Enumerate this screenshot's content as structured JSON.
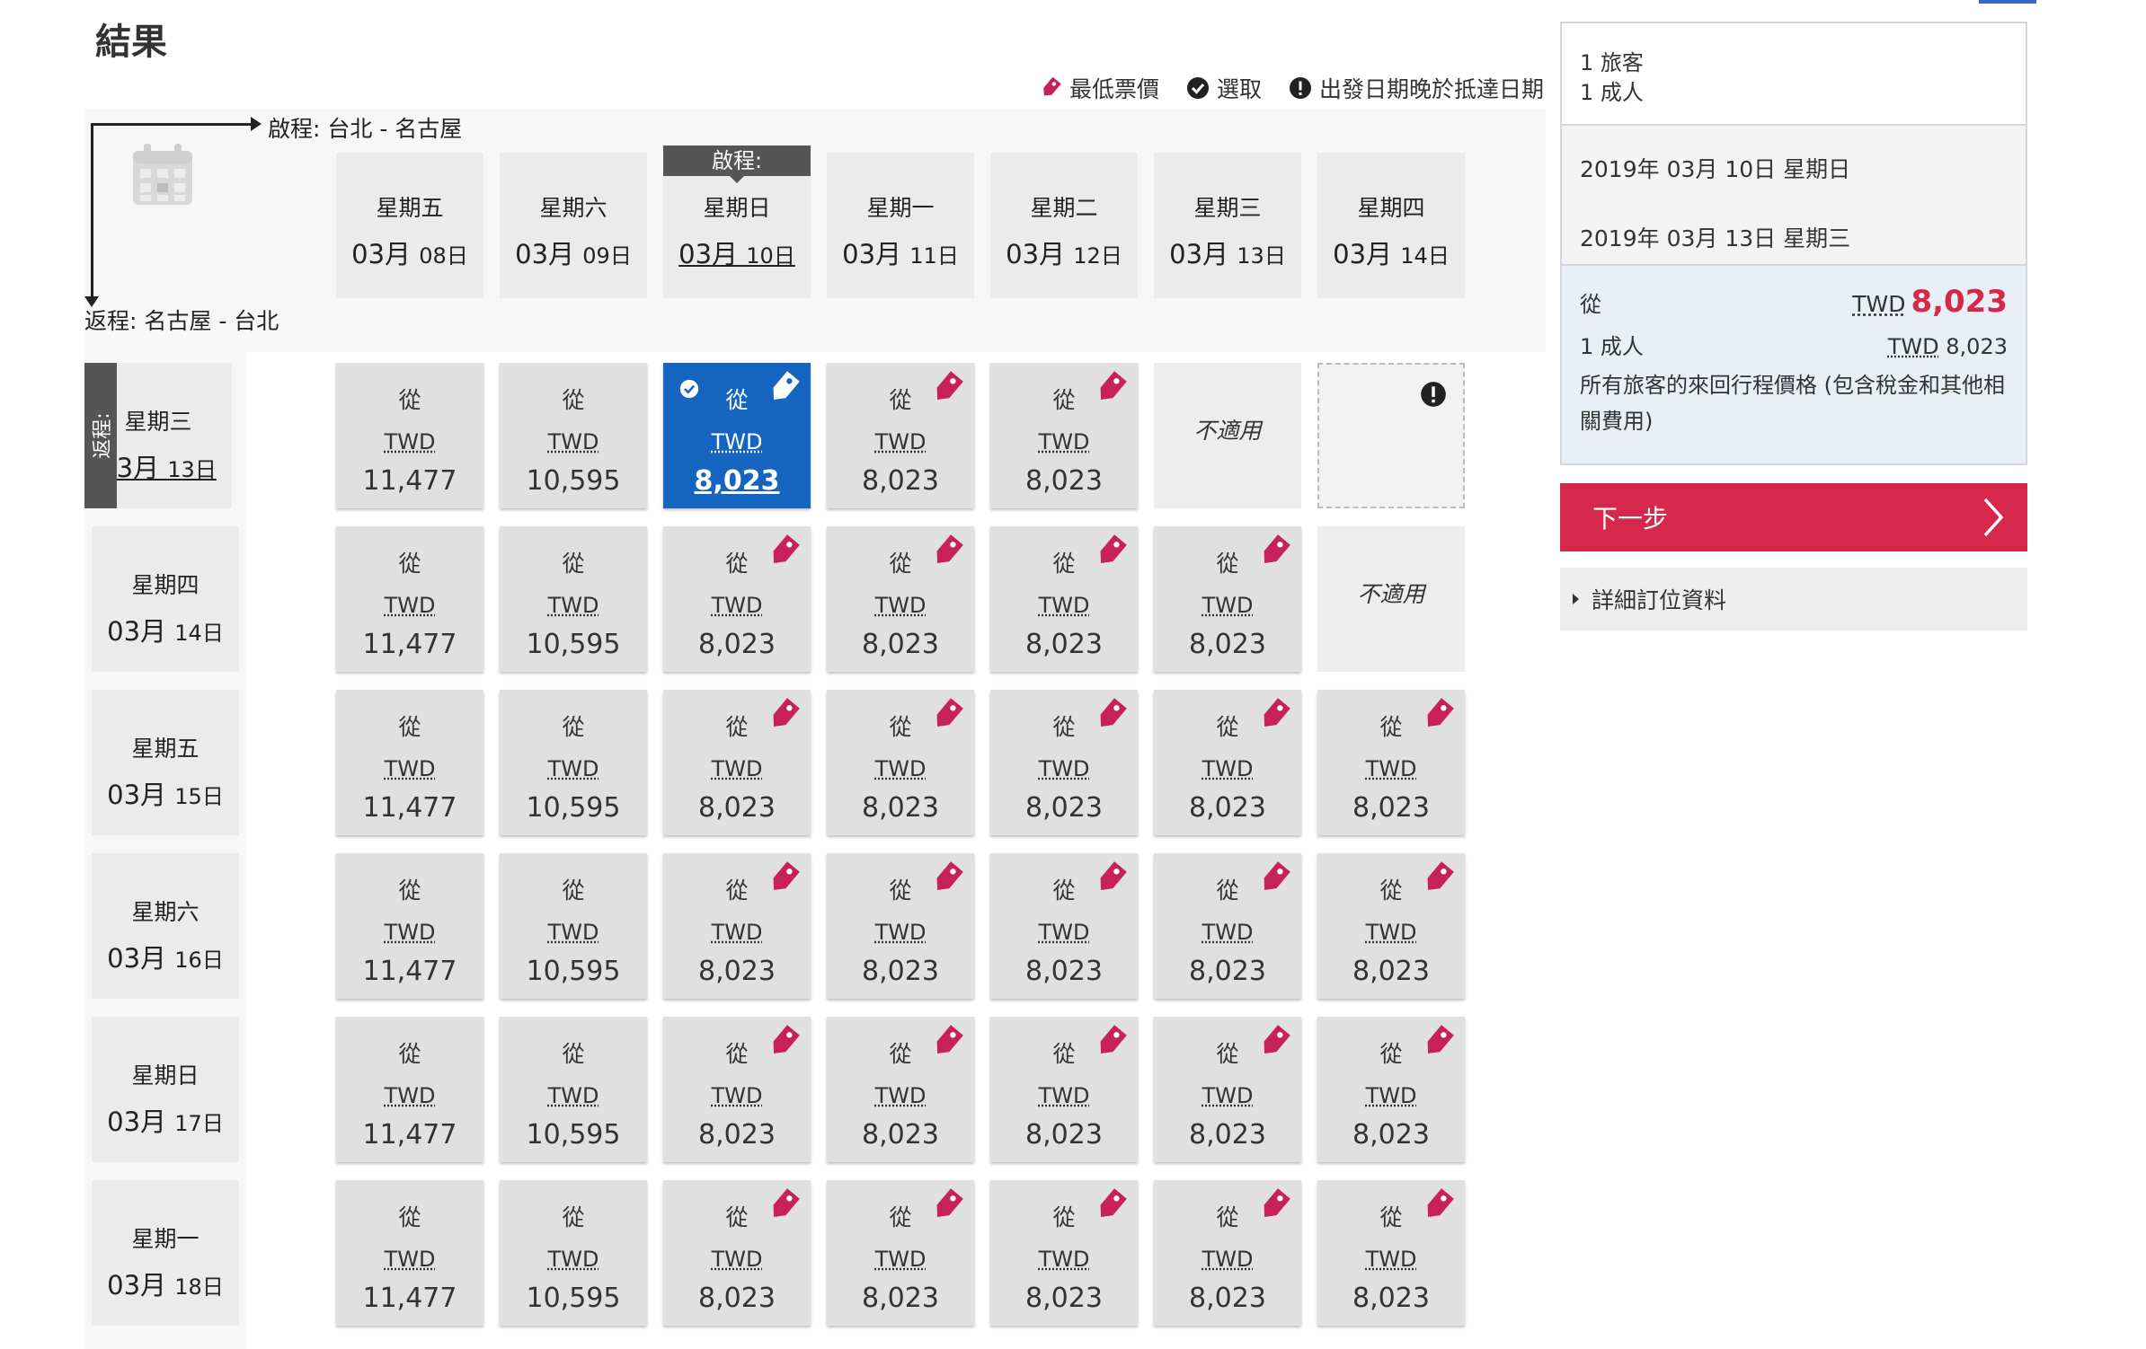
{
  "page_title": "結果",
  "legend": {
    "lowest_fare": "最低票價",
    "selected": "選取",
    "departure_after_arrival": "出發日期晚於抵達日期"
  },
  "grid": {
    "outbound_label": "啟程: 台北 - 名古屋",
    "return_label": "返程: 名古屋 - 台北",
    "selected_outbound_tag": "啟程:",
    "selected_return_tag": "返程:",
    "from_label": "從",
    "currency": "TWD",
    "not_applicable": "不適用",
    "columns": [
      {
        "dow": "星期五",
        "month": "03月",
        "day": "08日"
      },
      {
        "dow": "星期六",
        "month": "03月",
        "day": "09日"
      },
      {
        "dow": "星期日",
        "month": "03月",
        "day": "10日",
        "selected": true
      },
      {
        "dow": "星期一",
        "month": "03月",
        "day": "11日"
      },
      {
        "dow": "星期二",
        "month": "03月",
        "day": "12日"
      },
      {
        "dow": "星期三",
        "month": "03月",
        "day": "13日"
      },
      {
        "dow": "星期四",
        "month": "03月",
        "day": "14日"
      }
    ],
    "rows": [
      {
        "dow": "星期三",
        "month": "03月",
        "day": "13日",
        "selected": true
      },
      {
        "dow": "星期四",
        "month": "03月",
        "day": "14日"
      },
      {
        "dow": "星期五",
        "month": "03月",
        "day": "15日"
      },
      {
        "dow": "星期六",
        "month": "03月",
        "day": "16日"
      },
      {
        "dow": "星期日",
        "month": "03月",
        "day": "17日"
      },
      {
        "dow": "星期一",
        "month": "03月",
        "day": "18日"
      }
    ],
    "cells": [
      [
        {
          "kind": "price",
          "amount": "11,477",
          "lowest": false
        },
        {
          "kind": "price",
          "amount": "10,595",
          "lowest": false
        },
        {
          "kind": "price",
          "amount": "8,023",
          "lowest": true,
          "selected": true
        },
        {
          "kind": "price",
          "amount": "8,023",
          "lowest": true
        },
        {
          "kind": "price",
          "amount": "8,023",
          "lowest": true
        },
        {
          "kind": "na"
        },
        {
          "kind": "late"
        }
      ],
      [
        {
          "kind": "price",
          "amount": "11,477",
          "lowest": false
        },
        {
          "kind": "price",
          "amount": "10,595",
          "lowest": false
        },
        {
          "kind": "price",
          "amount": "8,023",
          "lowest": true
        },
        {
          "kind": "price",
          "amount": "8,023",
          "lowest": true
        },
        {
          "kind": "price",
          "amount": "8,023",
          "lowest": true
        },
        {
          "kind": "price",
          "amount": "8,023",
          "lowest": true
        },
        {
          "kind": "na"
        }
      ],
      [
        {
          "kind": "price",
          "amount": "11,477",
          "lowest": false
        },
        {
          "kind": "price",
          "amount": "10,595",
          "lowest": false
        },
        {
          "kind": "price",
          "amount": "8,023",
          "lowest": true
        },
        {
          "kind": "price",
          "amount": "8,023",
          "lowest": true
        },
        {
          "kind": "price",
          "amount": "8,023",
          "lowest": true
        },
        {
          "kind": "price",
          "amount": "8,023",
          "lowest": true
        },
        {
          "kind": "price",
          "amount": "8,023",
          "lowest": true
        }
      ],
      [
        {
          "kind": "price",
          "amount": "11,477",
          "lowest": false
        },
        {
          "kind": "price",
          "amount": "10,595",
          "lowest": false
        },
        {
          "kind": "price",
          "amount": "8,023",
          "lowest": true
        },
        {
          "kind": "price",
          "amount": "8,023",
          "lowest": true
        },
        {
          "kind": "price",
          "amount": "8,023",
          "lowest": true
        },
        {
          "kind": "price",
          "amount": "8,023",
          "lowest": true
        },
        {
          "kind": "price",
          "amount": "8,023",
          "lowest": true
        }
      ],
      [
        {
          "kind": "price",
          "amount": "11,477",
          "lowest": false
        },
        {
          "kind": "price",
          "amount": "10,595",
          "lowest": false
        },
        {
          "kind": "price",
          "amount": "8,023",
          "lowest": true
        },
        {
          "kind": "price",
          "amount": "8,023",
          "lowest": true
        },
        {
          "kind": "price",
          "amount": "8,023",
          "lowest": true
        },
        {
          "kind": "price",
          "amount": "8,023",
          "lowest": true
        },
        {
          "kind": "price",
          "amount": "8,023",
          "lowest": true
        }
      ],
      [
        {
          "kind": "price",
          "amount": "11,477",
          "lowest": false
        },
        {
          "kind": "price",
          "amount": "10,595",
          "lowest": false
        },
        {
          "kind": "price",
          "amount": "8,023",
          "lowest": true
        },
        {
          "kind": "price",
          "amount": "8,023",
          "lowest": true
        },
        {
          "kind": "price",
          "amount": "8,023",
          "lowest": true
        },
        {
          "kind": "price",
          "amount": "8,023",
          "lowest": true
        },
        {
          "kind": "price",
          "amount": "8,023",
          "lowest": true
        }
      ]
    ]
  },
  "summary": {
    "passengers": "1 旅客",
    "adults": "1 成人",
    "depart_date": "2019年 03月 10日 星期日",
    "return_date": "2019年 03月 13日 星期三",
    "from_label": "從",
    "total_currency": "TWD",
    "total_amount": "8,023",
    "adult_label": "1 成人",
    "adult_currency": "TWD",
    "adult_amount": "8,023",
    "note": "所有旅客的來回行程價格 (包含稅金和其他相關費用)",
    "next_button": "下一步",
    "details_link": "詳細訂位資料"
  },
  "colors": {
    "accent_red": "#d6284a",
    "selected_blue": "#1565c0",
    "cell_gray": "#e0e0e0"
  },
  "icons": {
    "lowest_fare": "price-tag-icon",
    "selected": "check-circle-icon",
    "warning": "exclamation-circle-icon",
    "calendar": "calendar-icon",
    "next": "chevron-right-icon"
  }
}
